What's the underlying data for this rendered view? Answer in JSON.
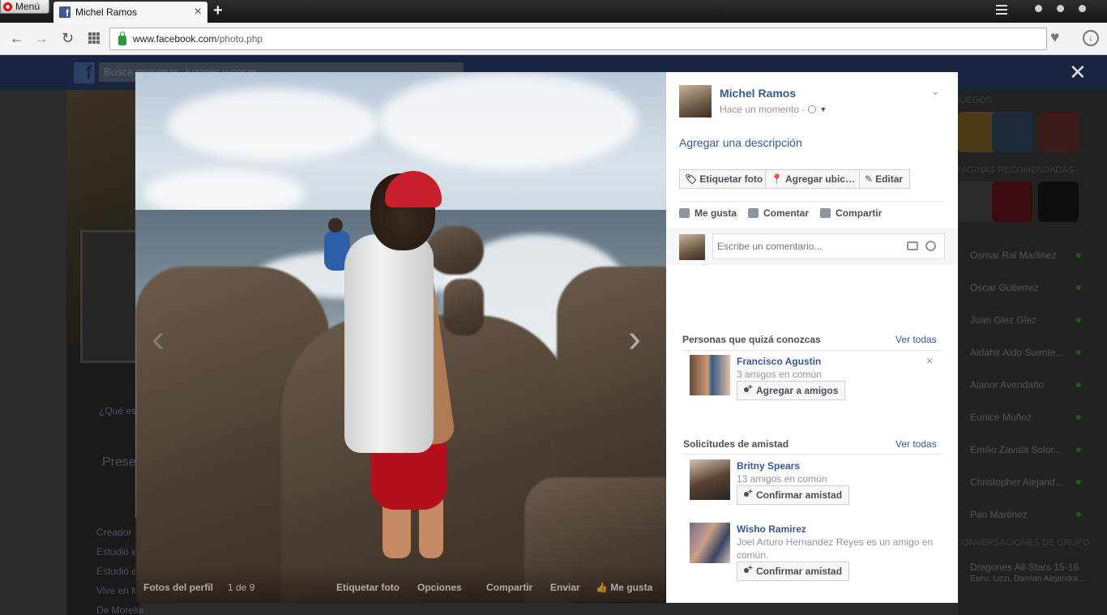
{
  "browser": {
    "menu_label": "Menú",
    "tab_title": "Michel Ramos",
    "url_domain": "www.facebook.com",
    "url_path": "/photo.php"
  },
  "background": {
    "search_placeholder": "Busca personas, lugares y cosas",
    "left_items": [
      "¿Qué estás pensando?",
      "Presentación",
      "Creador",
      "Estudió e",
      "Estudió e",
      "Vive en M",
      "De Morelia"
    ],
    "right_sections": [
      "Juegos",
      "Páginas recomendadas",
      "Conversaciones de grupo"
    ],
    "friends": [
      "Osmar Rai Martinez",
      "Oscar Gutierrez",
      "Juan Glez Glez",
      "Aldahir Aldo Suente...",
      "Alanor Avendaño",
      "Eunice Muñoz",
      "Emilio Zavala Solor...",
      "Christopher Alejand...",
      "Pao Martinez"
    ],
    "group_chat": "Dragones All-Stars 15-16",
    "group_members": "Eseu, Lizzi, Damian Alejandra..."
  },
  "photo_bar": {
    "album": "Fotos del perfil",
    "counter": "1 de 9",
    "tag": "Etiquetar foto",
    "options": "Opciones",
    "share": "Compartir",
    "send": "Enviar",
    "like": "Me gusta"
  },
  "post": {
    "author": "Michel Ramos",
    "time": "Hace un momento ·",
    "add_description": "Agregar una descripción",
    "tag_photo": "Etiquetar foto",
    "add_location": "Agregar ubic…",
    "edit": "Editar",
    "like": "Me gusta",
    "comment": "Comentar",
    "share": "Compartir",
    "comment_placeholder": "Escribe un comentario..."
  },
  "suggestions": {
    "title": "Personas que quizá conozcas",
    "see_all": "Ver todas",
    "people": [
      {
        "name": "Francisco Agustin",
        "mutual": "3 amigos en común",
        "action": "Agregar a amigos"
      }
    ]
  },
  "requests": {
    "title": "Solicitudes de amistad",
    "see_all": "Ver todas",
    "people": [
      {
        "name": "Britny Spears",
        "mutual": "13 amigos en común",
        "action": "Confirmar amistad"
      },
      {
        "name": "Wisho Ramirez",
        "mutual": "Joel Arturo Hernandez Reyes es un amigo en común.",
        "action": "Confirmar amistad"
      }
    ]
  },
  "colors": {
    "fb_blue": "#365899",
    "panel_bg": "#ffffff",
    "overlay": "#151515"
  }
}
